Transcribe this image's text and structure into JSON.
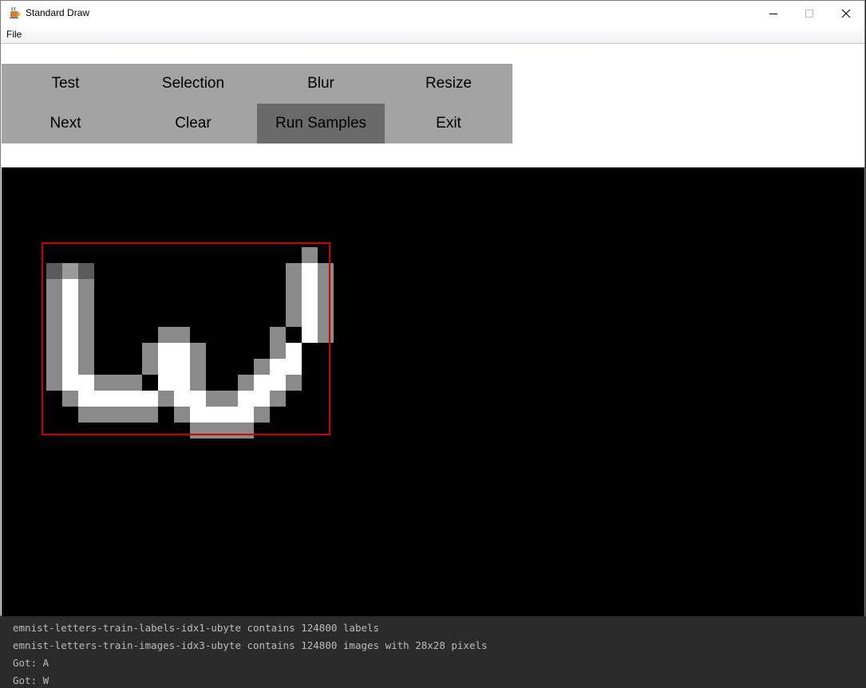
{
  "window": {
    "title": "Standard Draw",
    "minimize_icon": "minimize-icon",
    "maximize_icon": "maximize-icon",
    "close_icon": "close-icon",
    "app_icon": "java-icon"
  },
  "menu": {
    "file_label": "File"
  },
  "toolbar": {
    "buttons": [
      {
        "label": "Test"
      },
      {
        "label": "Selection"
      },
      {
        "label": "Blur"
      },
      {
        "label": "Resize"
      },
      {
        "label": "Next"
      },
      {
        "label": "Clear"
      },
      {
        "label": "Run Samples",
        "pressed": true
      },
      {
        "label": "Exit"
      }
    ]
  },
  "colors": {
    "toolbar_bg": "#a3a3a3",
    "pressed_bg": "#6a6a6a",
    "selection_box": "#d40000",
    "canvas_bg": "#000000",
    "console_bg": "#2b2b2b"
  },
  "canvas": {
    "drawing": "pixelated handwritten letter W",
    "selection_box_color": "#d40000"
  },
  "console": {
    "lines": [
      "emnist-letters-train-labels-idx1-ubyte contains 124800 labels",
      "emnist-letters-train-images-idx3-ubyte contains 124800 images with 28x28 pixels",
      "Got: A",
      "Got: W"
    ]
  }
}
